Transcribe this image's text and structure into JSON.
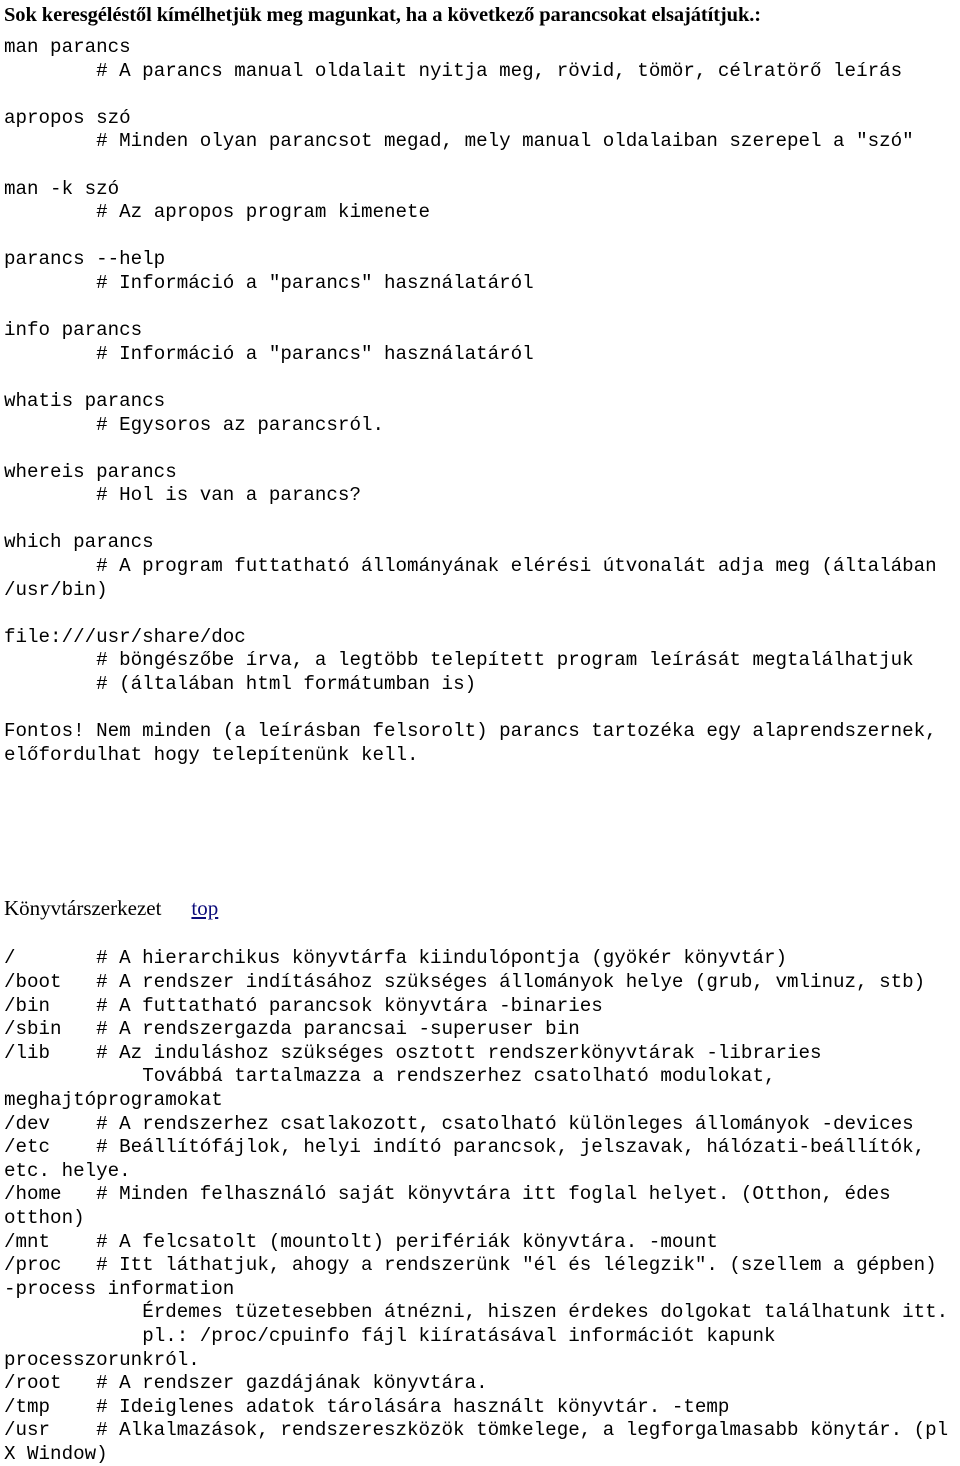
{
  "document": {
    "heading": "Sok keresgéléstől kímélhetjük meg magunkat, ha a következő parancsokat elsajátítjuk.:",
    "commands_block": "man parancs\n        # A parancs manual oldalait nyitja meg, rövid, tömör, célratörő leírás\n\napropos szó\n        # Minden olyan parancsot megad, mely manual oldalaiban szerepel a \"szó\"\n\nman -k szó\n        # Az apropos program kimenete\n\nparancs --help\n        # Információ a \"parancs\" használatáról\n\ninfo parancs\n        # Információ a \"parancs\" használatáról\n\nwhatis parancs\n        # Egysoros az parancsról.\n\nwhereis parancs\n        # Hol is van a parancs?\n\nwhich parancs\n        # A program futtatható állományának elérési útvonalát adja meg (általában /usr/bin)\n\nfile:///usr/share/doc\n        # böngészőbe írva, a legtöbb telepített program leírását megtalálhatjuk\n        # (általában html formátumban is)\n\nFontos! Nem minden (a leírásban felsorolt) parancs tartozéka egy alaprendszernek, előfordulhat hogy telepítenünk kell.",
    "section_title": "Könyvtárszerkezet",
    "top_link": "top",
    "directory_block": "/       # A hierarchikus könyvtárfa kiindulópontja (gyökér könyvtár)\n/boot   # A rendszer indításához szükséges állományok helye (grub, vmlinuz, stb)\n/bin    # A futtatható parancsok könyvtára -binaries\n/sbin   # A rendszergazda parancsai -superuser bin\n/lib    # Az induláshoz szükséges osztott rendszerkönyvtárak -libraries\n            Továbbá tartalmazza a rendszerhez csatolható modulokat, meghajtóprogramokat\n/dev    # A rendszerhez csatlakozott, csatolható különleges állományok -devices\n/etc    # Beállítófájlok, helyi indító parancsok, jelszavak, hálózati-beállítók, etc. helye.\n/home   # Minden felhasználó saját könyvtára itt foglal helyet. (Otthon, édes otthon)\n/mnt    # A felcsatolt (mountolt) perifériák könyvtára. -mount\n/proc   # Itt láthatjuk, ahogy a rendszerünk \"él és lélegzik\". (szellem a gépben) -process information\n            Érdemes tüzetesebben átnézni, hiszen érdekes dolgokat találhatunk itt.\n            pl.: /proc/cpuinfo fájl kiíratásával információt kapunk processzorunkról.\n/root   # A rendszer gazdájának könyvtára.\n/tmp    # Ideiglenes adatok tárolására használt könyvtár. -temp\n/usr    # Alkalmazások, rendszereszközök tömkelege, a legforgalmasabb könytár. (pl X Window)"
  },
  "colors": {
    "link": "#0b0b7a",
    "text": "#000000",
    "background": "#ffffff"
  }
}
